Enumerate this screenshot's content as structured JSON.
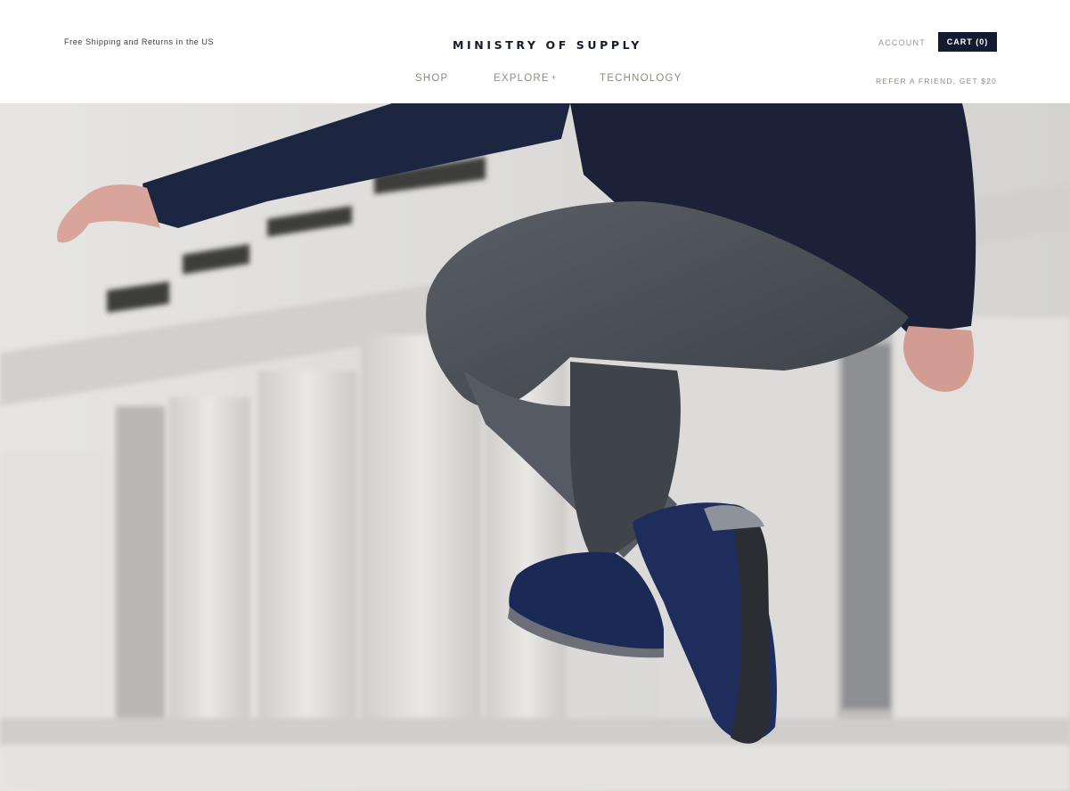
{
  "header": {
    "promo": "Free Shipping and Returns in the US",
    "brand": "MINISTRY OF SUPPLY",
    "account_label": "ACCOUNT",
    "cart_label": "CART (0)",
    "refer_label": "REFER A FRIEND, GET $20",
    "nav": [
      {
        "label": "SHOP"
      },
      {
        "label": "EXPLORE"
      },
      {
        "label": "TECHNOLOGY"
      }
    ]
  },
  "hero": {
    "image_subject": "man jumping in navy jacket, grey trousers and navy suede boots"
  },
  "colors": {
    "brand_navy": "#141a31",
    "nav_text": "#8f8b84",
    "background": "#ffffff"
  }
}
